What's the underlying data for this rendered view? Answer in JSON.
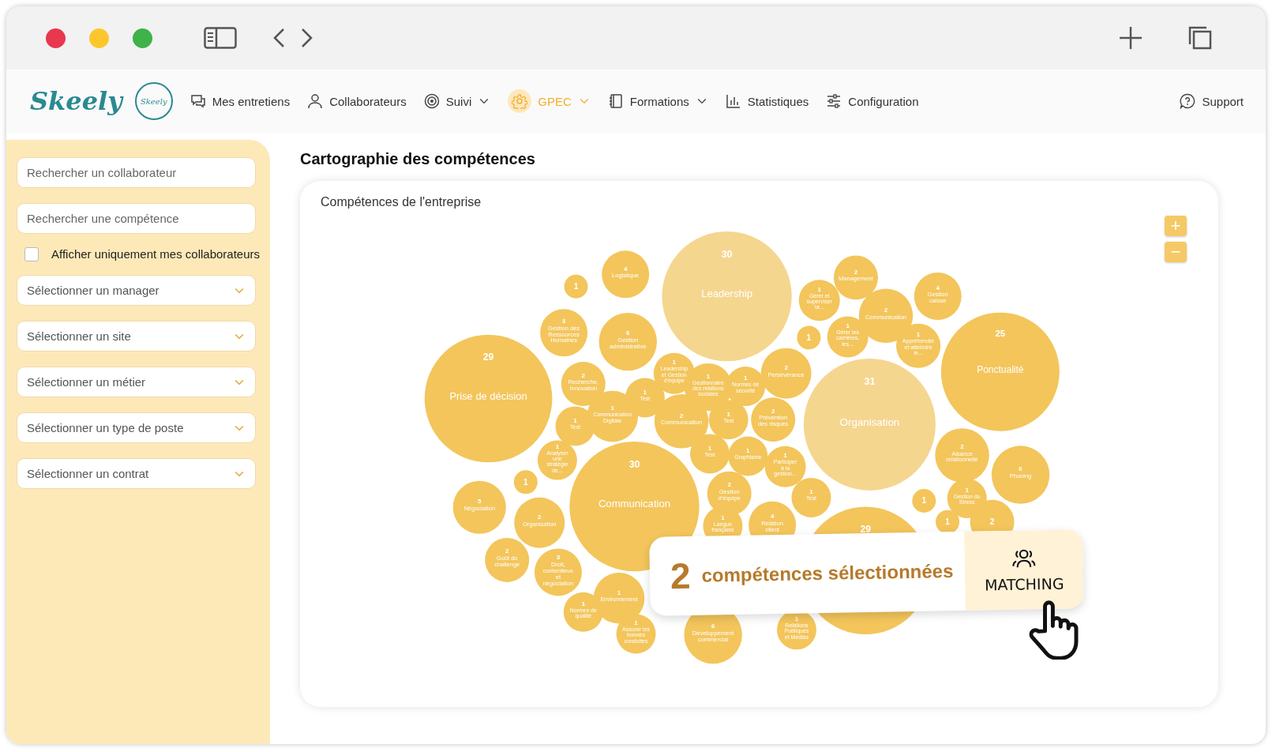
{
  "nav": {
    "logo": "Skeely",
    "badge": "Skeely",
    "items": [
      {
        "label": "Mes entretiens",
        "dropdown": false,
        "selected": false
      },
      {
        "label": "Collaborateurs",
        "dropdown": false,
        "selected": false
      },
      {
        "label": "Suivi",
        "dropdown": true,
        "selected": false
      },
      {
        "label": "GPEC",
        "dropdown": true,
        "selected": true
      },
      {
        "label": "Formations",
        "dropdown": true,
        "selected": false
      },
      {
        "label": "Statistiques",
        "dropdown": false,
        "selected": false
      },
      {
        "label": "Configuration",
        "dropdown": false,
        "selected": false
      }
    ],
    "support": "Support"
  },
  "sidebar": {
    "search_fields": [
      {
        "placeholder": "Rechercher un collaborateur"
      },
      {
        "placeholder": "Rechercher une compétence"
      }
    ],
    "checkbox": {
      "label": "Afficher uniquement mes collaborateurs",
      "checked": false
    },
    "selects": [
      {
        "placeholder": "Sélectionner un manager"
      },
      {
        "placeholder": "Sélectionner un site"
      },
      {
        "placeholder": "Sélectionner un métier"
      },
      {
        "placeholder": "Sélectionner un type de poste"
      },
      {
        "placeholder": "Sélectionner un contrat"
      }
    ]
  },
  "page_title": "Cartographie des compétences",
  "card": {
    "title": "Compétences de l'entreprise",
    "zoom_in": "+",
    "zoom_out": "−",
    "bubbles": [
      {
        "count": "4",
        "label": "Logistique",
        "selected": false
      },
      {
        "count": "2",
        "label": "Management",
        "selected": false
      },
      {
        "count": "1",
        "selected": false
      },
      {
        "count": "30",
        "label": "Leadership",
        "selected": true
      },
      {
        "count": "1",
        "label": "Gérer et superviser la...",
        "selected": false
      },
      {
        "count": "4",
        "label": "Gestion caisse",
        "selected": false
      },
      {
        "count": "2",
        "label": "Communication",
        "selected": false
      },
      {
        "count": "3",
        "label": "Gestion des Ressources Humaines",
        "selected": false
      },
      {
        "count": "6",
        "label": "Gestion administrative",
        "selected": false
      },
      {
        "count": "1",
        "selected": false
      },
      {
        "count": "1",
        "label": "Gérer les carrières, les...",
        "selected": false
      },
      {
        "count": "1",
        "label": "Appréhender et atteindre le...",
        "selected": false
      },
      {
        "count": "1",
        "label": "Leadership et Gestion d'équipe",
        "selected": false
      },
      {
        "count": "2",
        "label": "Persévérance",
        "selected": false
      },
      {
        "count": "25",
        "label": "Ponctualité",
        "selected": false
      },
      {
        "count": "2",
        "label": "Recherche, Innovation",
        "selected": false
      },
      {
        "count": "1",
        "label": "Gestionnaire des relations sociales",
        "selected": false
      },
      {
        "count": "1",
        "label": "Normes de sécurité",
        "selected": false
      },
      {
        "count": "29",
        "label": "Prise de décision",
        "selected": false
      },
      {
        "count": "1",
        "label": "Test",
        "selected": false
      },
      {
        "count": "1",
        "label": "Test",
        "selected": false
      },
      {
        "count": "1",
        "label": "Communication Digitale",
        "selected": false
      },
      {
        "count": "2",
        "label": "Communication",
        "selected": false
      },
      {
        "count": "1",
        "label": "Test",
        "selected": false
      },
      {
        "count": "2",
        "label": "Prévention des risques",
        "selected": false
      },
      {
        "count": "31",
        "label": "Organisation",
        "selected": true
      },
      {
        "count": "1",
        "label": "Analyser une stratégie de...",
        "selected": false
      },
      {
        "count": "1",
        "label": "Test",
        "selected": false
      },
      {
        "count": "1",
        "label": "Graphisme",
        "selected": false
      },
      {
        "count": "2",
        "label": "Aisance relationnelle",
        "selected": false
      },
      {
        "count": "1",
        "label": "Participer à la gestion...",
        "selected": false
      },
      {
        "count": "6",
        "label": "Phoning",
        "selected": false
      },
      {
        "count": "1",
        "selected": false
      },
      {
        "count": "2",
        "label": "Gestion d'équipe",
        "selected": false
      },
      {
        "count": "1",
        "label": "Test",
        "selected": false
      },
      {
        "count": "1",
        "selected": false
      },
      {
        "count": "1",
        "label": "Gestion du Stress",
        "selected": false
      },
      {
        "count": "5",
        "label": "Négociation",
        "selected": false
      },
      {
        "count": "30",
        "label": "Communication",
        "selected": false
      },
      {
        "count": "2",
        "label": "Organisation",
        "selected": false
      },
      {
        "count": "1",
        "label": "Langue française",
        "selected": false
      },
      {
        "count": "4",
        "label": "Relation client",
        "selected": false
      },
      {
        "count": "1",
        "selected": false
      },
      {
        "count": "2",
        "selected": false
      },
      {
        "count": "2",
        "label": "Goût du challenge",
        "selected": false
      },
      {
        "count": "3",
        "label": "Droit, contentieux et négociation",
        "selected": false
      },
      {
        "count": "29",
        "selected": false
      },
      {
        "count": "1",
        "label": "Environnement",
        "selected": false
      },
      {
        "count": "1",
        "label": "Normes de qualité",
        "selected": false
      },
      {
        "count": "1",
        "label": "Assurer les bonnes conduites",
        "selected": false
      },
      {
        "count": "6",
        "label": "Développement commercial",
        "selected": false
      },
      {
        "count": "1",
        "label": "Relations Publiques et Médias",
        "selected": false
      }
    ],
    "selection": {
      "count": "2",
      "text": "compétences sélectionnées",
      "button": "MATCHING"
    }
  }
}
